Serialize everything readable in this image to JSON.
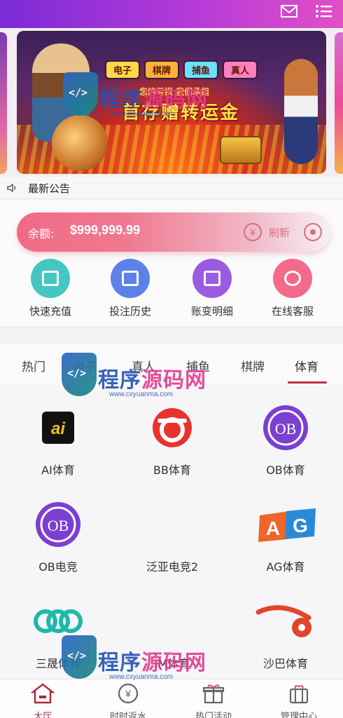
{
  "header": {
    "mail_icon": "mail-icon",
    "menu_icon": "list-menu-icon",
    "gradient": [
      "#7b2bd6",
      "#e24fc6"
    ]
  },
  "banner": {
    "tags": [
      "电子",
      "棋牌",
      "捕鱼",
      "真人"
    ],
    "subline": "您的亏损 我们承担",
    "headline": "首存赠转运金"
  },
  "notice": {
    "label": "最新公告",
    "icon": "speaker-icon"
  },
  "wallet": {
    "balance_label": "余额:",
    "balance_value": "$999,999.99",
    "currency_glyph": "¥",
    "refresh_label": "刷新",
    "actions": [
      {
        "label": "快速充值",
        "icon": "card-icon",
        "color": "#43c7c0"
      },
      {
        "label": "投注历史",
        "icon": "edit-icon",
        "color": "#5c82e8"
      },
      {
        "label": "账变明细",
        "icon": "wallet-icon",
        "color": "#9b5be0"
      },
      {
        "label": "在线客服",
        "icon": "support-icon",
        "color": "#f36a8a"
      }
    ]
  },
  "categories": {
    "items": [
      "热门",
      "电子",
      "真人",
      "捕鱼",
      "棋牌",
      "体育"
    ],
    "active": "体育",
    "accent": "#c1313f"
  },
  "games": [
    {
      "name": "AI体育",
      "icon": "ai-logo-icon"
    },
    {
      "name": "BB体育",
      "icon": "bb-logo-icon"
    },
    {
      "name": "OB体育",
      "icon": "ob-logo-icon"
    },
    {
      "name": "OB电竞",
      "icon": "ob-logo-icon"
    },
    {
      "name": "泛亚电竞2",
      "icon": "fanya-logo-icon"
    },
    {
      "name": "AG体育",
      "icon": "ag-logo-icon"
    },
    {
      "name": "三晟体育",
      "icon": "sansheng-logo-icon"
    },
    {
      "name": "IM体育",
      "icon": "im-logo-icon"
    },
    {
      "name": "沙巴体育",
      "icon": "shaba-logo-icon"
    }
  ],
  "tabbar": [
    {
      "label": "大厅",
      "icon": "home-icon",
      "active": true
    },
    {
      "label": "时时返水",
      "icon": "yen-coin-icon",
      "active": false
    },
    {
      "label": "热门活动",
      "icon": "gift-icon",
      "active": false
    },
    {
      "label": "管理中心",
      "icon": "gift-box-icon",
      "active": false
    }
  ],
  "watermark": {
    "title_a": "程序",
    "title_b": "源码网",
    "url": "www.cxyuanma.com"
  }
}
